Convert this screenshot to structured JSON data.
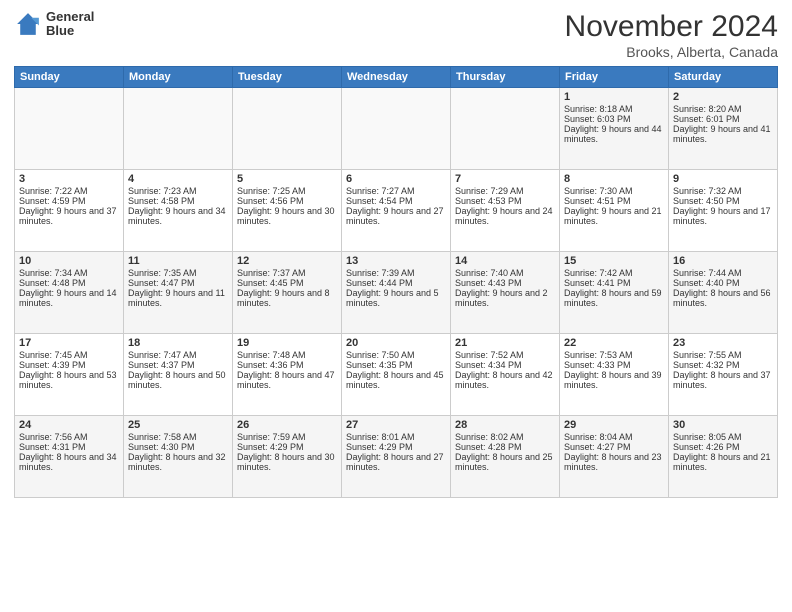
{
  "header": {
    "logo_line1": "General",
    "logo_line2": "Blue",
    "month_title": "November 2024",
    "location": "Brooks, Alberta, Canada"
  },
  "days_of_week": [
    "Sunday",
    "Monday",
    "Tuesday",
    "Wednesday",
    "Thursday",
    "Friday",
    "Saturday"
  ],
  "weeks": [
    [
      {
        "day": "",
        "sunrise": "",
        "sunset": "",
        "daylight": ""
      },
      {
        "day": "",
        "sunrise": "",
        "sunset": "",
        "daylight": ""
      },
      {
        "day": "",
        "sunrise": "",
        "sunset": "",
        "daylight": ""
      },
      {
        "day": "",
        "sunrise": "",
        "sunset": "",
        "daylight": ""
      },
      {
        "day": "",
        "sunrise": "",
        "sunset": "",
        "daylight": ""
      },
      {
        "day": "1",
        "sunrise": "Sunrise: 8:18 AM",
        "sunset": "Sunset: 6:03 PM",
        "daylight": "Daylight: 9 hours and 44 minutes."
      },
      {
        "day": "2",
        "sunrise": "Sunrise: 8:20 AM",
        "sunset": "Sunset: 6:01 PM",
        "daylight": "Daylight: 9 hours and 41 minutes."
      }
    ],
    [
      {
        "day": "3",
        "sunrise": "Sunrise: 7:22 AM",
        "sunset": "Sunset: 4:59 PM",
        "daylight": "Daylight: 9 hours and 37 minutes."
      },
      {
        "day": "4",
        "sunrise": "Sunrise: 7:23 AM",
        "sunset": "Sunset: 4:58 PM",
        "daylight": "Daylight: 9 hours and 34 minutes."
      },
      {
        "day": "5",
        "sunrise": "Sunrise: 7:25 AM",
        "sunset": "Sunset: 4:56 PM",
        "daylight": "Daylight: 9 hours and 30 minutes."
      },
      {
        "day": "6",
        "sunrise": "Sunrise: 7:27 AM",
        "sunset": "Sunset: 4:54 PM",
        "daylight": "Daylight: 9 hours and 27 minutes."
      },
      {
        "day": "7",
        "sunrise": "Sunrise: 7:29 AM",
        "sunset": "Sunset: 4:53 PM",
        "daylight": "Daylight: 9 hours and 24 minutes."
      },
      {
        "day": "8",
        "sunrise": "Sunrise: 7:30 AM",
        "sunset": "Sunset: 4:51 PM",
        "daylight": "Daylight: 9 hours and 21 minutes."
      },
      {
        "day": "9",
        "sunrise": "Sunrise: 7:32 AM",
        "sunset": "Sunset: 4:50 PM",
        "daylight": "Daylight: 9 hours and 17 minutes."
      }
    ],
    [
      {
        "day": "10",
        "sunrise": "Sunrise: 7:34 AM",
        "sunset": "Sunset: 4:48 PM",
        "daylight": "Daylight: 9 hours and 14 minutes."
      },
      {
        "day": "11",
        "sunrise": "Sunrise: 7:35 AM",
        "sunset": "Sunset: 4:47 PM",
        "daylight": "Daylight: 9 hours and 11 minutes."
      },
      {
        "day": "12",
        "sunrise": "Sunrise: 7:37 AM",
        "sunset": "Sunset: 4:45 PM",
        "daylight": "Daylight: 9 hours and 8 minutes."
      },
      {
        "day": "13",
        "sunrise": "Sunrise: 7:39 AM",
        "sunset": "Sunset: 4:44 PM",
        "daylight": "Daylight: 9 hours and 5 minutes."
      },
      {
        "day": "14",
        "sunrise": "Sunrise: 7:40 AM",
        "sunset": "Sunset: 4:43 PM",
        "daylight": "Daylight: 9 hours and 2 minutes."
      },
      {
        "day": "15",
        "sunrise": "Sunrise: 7:42 AM",
        "sunset": "Sunset: 4:41 PM",
        "daylight": "Daylight: 8 hours and 59 minutes."
      },
      {
        "day": "16",
        "sunrise": "Sunrise: 7:44 AM",
        "sunset": "Sunset: 4:40 PM",
        "daylight": "Daylight: 8 hours and 56 minutes."
      }
    ],
    [
      {
        "day": "17",
        "sunrise": "Sunrise: 7:45 AM",
        "sunset": "Sunset: 4:39 PM",
        "daylight": "Daylight: 8 hours and 53 minutes."
      },
      {
        "day": "18",
        "sunrise": "Sunrise: 7:47 AM",
        "sunset": "Sunset: 4:37 PM",
        "daylight": "Daylight: 8 hours and 50 minutes."
      },
      {
        "day": "19",
        "sunrise": "Sunrise: 7:48 AM",
        "sunset": "Sunset: 4:36 PM",
        "daylight": "Daylight: 8 hours and 47 minutes."
      },
      {
        "day": "20",
        "sunrise": "Sunrise: 7:50 AM",
        "sunset": "Sunset: 4:35 PM",
        "daylight": "Daylight: 8 hours and 45 minutes."
      },
      {
        "day": "21",
        "sunrise": "Sunrise: 7:52 AM",
        "sunset": "Sunset: 4:34 PM",
        "daylight": "Daylight: 8 hours and 42 minutes."
      },
      {
        "day": "22",
        "sunrise": "Sunrise: 7:53 AM",
        "sunset": "Sunset: 4:33 PM",
        "daylight": "Daylight: 8 hours and 39 minutes."
      },
      {
        "day": "23",
        "sunrise": "Sunrise: 7:55 AM",
        "sunset": "Sunset: 4:32 PM",
        "daylight": "Daylight: 8 hours and 37 minutes."
      }
    ],
    [
      {
        "day": "24",
        "sunrise": "Sunrise: 7:56 AM",
        "sunset": "Sunset: 4:31 PM",
        "daylight": "Daylight: 8 hours and 34 minutes."
      },
      {
        "day": "25",
        "sunrise": "Sunrise: 7:58 AM",
        "sunset": "Sunset: 4:30 PM",
        "daylight": "Daylight: 8 hours and 32 minutes."
      },
      {
        "day": "26",
        "sunrise": "Sunrise: 7:59 AM",
        "sunset": "Sunset: 4:29 PM",
        "daylight": "Daylight: 8 hours and 30 minutes."
      },
      {
        "day": "27",
        "sunrise": "Sunrise: 8:01 AM",
        "sunset": "Sunset: 4:29 PM",
        "daylight": "Daylight: 8 hours and 27 minutes."
      },
      {
        "day": "28",
        "sunrise": "Sunrise: 8:02 AM",
        "sunset": "Sunset: 4:28 PM",
        "daylight": "Daylight: 8 hours and 25 minutes."
      },
      {
        "day": "29",
        "sunrise": "Sunrise: 8:04 AM",
        "sunset": "Sunset: 4:27 PM",
        "daylight": "Daylight: 8 hours and 23 minutes."
      },
      {
        "day": "30",
        "sunrise": "Sunrise: 8:05 AM",
        "sunset": "Sunset: 4:26 PM",
        "daylight": "Daylight: 8 hours and 21 minutes."
      }
    ]
  ]
}
